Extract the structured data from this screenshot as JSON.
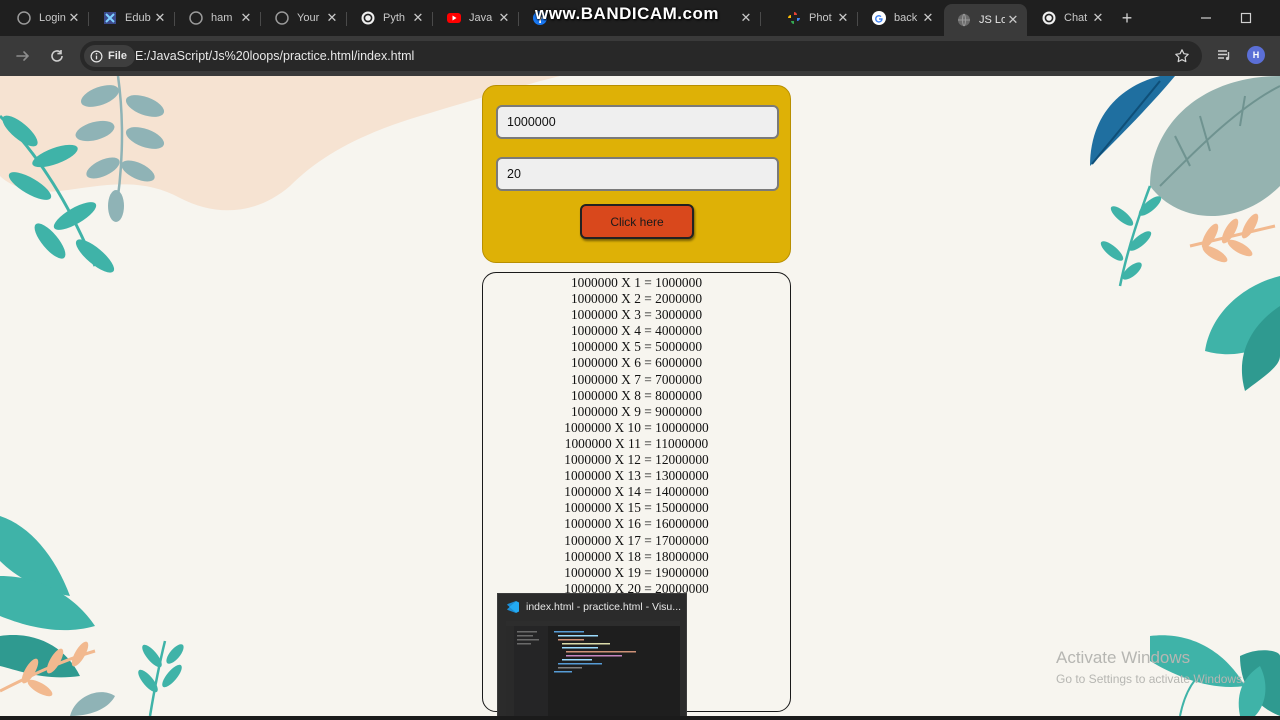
{
  "browser": {
    "tabs": [
      {
        "label": "Login",
        "icon": "loading-icon"
      },
      {
        "label": "Edub",
        "icon": "edube-icon"
      },
      {
        "label": "ham",
        "icon": "loading-icon"
      },
      {
        "label": "Your",
        "icon": "loading-icon"
      },
      {
        "label": "Pyth",
        "icon": "openai-icon"
      },
      {
        "label": "Java",
        "icon": "youtube-icon"
      },
      {
        "label": "",
        "icon": "facebook-icon"
      },
      {
        "label": "Phot",
        "icon": "photos-icon"
      },
      {
        "label": "back",
        "icon": "google-icon"
      },
      {
        "label": "JS Lo",
        "icon": "globe-icon",
        "active": true
      },
      {
        "label": "Chat",
        "icon": "openai-icon"
      }
    ],
    "watermark": "www.BANDICAM.com",
    "address": {
      "scheme_chip": "File",
      "url": "E:/JavaScript/Js%20loops/practice.html/index.html"
    },
    "profile_initial": "H"
  },
  "page": {
    "number_value": "1000000",
    "limit_value": "20",
    "button_label": "Click here",
    "results": [
      "1000000 X 1 = 1000000",
      "1000000 X 2 = 2000000",
      "1000000 X 3 = 3000000",
      "1000000 X 4 = 4000000",
      "1000000 X 5 = 5000000",
      "1000000 X 6 = 6000000",
      "1000000 X 7 = 7000000",
      "1000000 X 8 = 8000000",
      "1000000 X 9 = 9000000",
      "1000000 X 10 = 10000000",
      "1000000 X 11 = 11000000",
      "1000000 X 12 = 12000000",
      "1000000 X 13 = 13000000",
      "1000000 X 14 = 14000000",
      "1000000 X 15 = 15000000",
      "1000000 X 16 = 16000000",
      "1000000 X 17 = 17000000",
      "1000000 X 18 = 18000000",
      "1000000 X 19 = 19000000",
      "1000000 X 20 = 20000000"
    ]
  },
  "os": {
    "activate_title": "Activate Windows",
    "activate_subtitle": "Go to Settings to activate Windows.",
    "preview_title": "index.html - practice.html - Visu..."
  },
  "colors": {
    "form_card": "#deb106",
    "button": "#d9481c",
    "page_bg": "#f7f5ef",
    "leaf_teal": "#3fb3a8",
    "leaf_blue": "#1f6fa0",
    "leaf_peach": "#f2b98f"
  }
}
